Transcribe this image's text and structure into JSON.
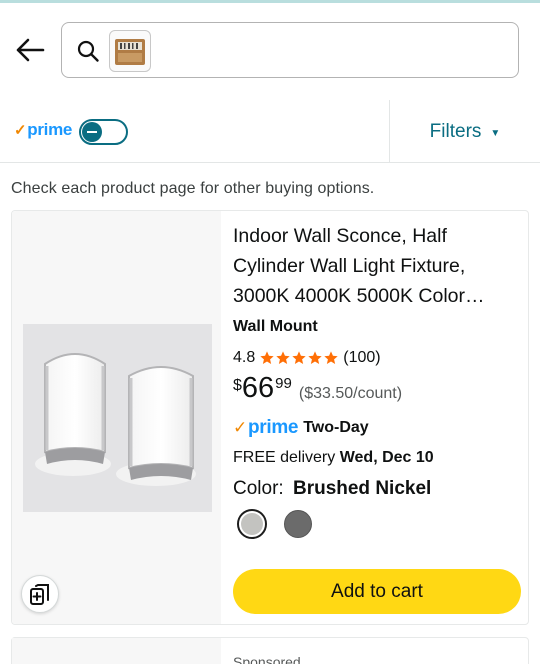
{
  "search": {
    "placeholder": "",
    "thumbnail_alt": "image search thumbnail"
  },
  "filter_bar": {
    "prime_label": "prime",
    "prime_toggle_on": false,
    "filters_label": "Filters"
  },
  "notice": "Check each product page for other buying options.",
  "product": {
    "title": "Indoor Wall Sconce, Half Cylinder Wall Light Fixture, 3000K 4000K 5000K Color…",
    "brand": "Wall Mount",
    "rating": "4.8",
    "stars": 4.8,
    "rating_count": "(100)",
    "price_symbol": "$",
    "price_whole": "66",
    "price_fraction": "99",
    "unit_price": "($33.50/count)",
    "prime_label": "prime",
    "prime_speed": "Two-Day",
    "delivery_prefix": "FREE delivery",
    "delivery_date": "Wed, Dec 10",
    "color_label": "Color:",
    "color_value": "Brushed Nickel",
    "swatches": [
      {
        "name": "Brushed Nickel",
        "color": "#c3c3c0",
        "selected": true
      },
      {
        "name": "Dark Gray",
        "color": "#6b6b6b",
        "selected": false
      }
    ],
    "add_to_cart_label": "Add to cart"
  },
  "next_card": {
    "sponsored_label": "Sponsored"
  },
  "colors": {
    "prime_blue": "#1a98ff",
    "prime_check": "#f08804",
    "link_teal": "#0a6d82",
    "star_orange": "#ff6f06",
    "cart_yellow": "#ffd814"
  },
  "icons": {
    "back": "arrow-left-icon",
    "search": "magnifier-icon",
    "compare": "compare-add-icon",
    "star": "star-icon",
    "filters_caret": "caret-down-icon"
  }
}
